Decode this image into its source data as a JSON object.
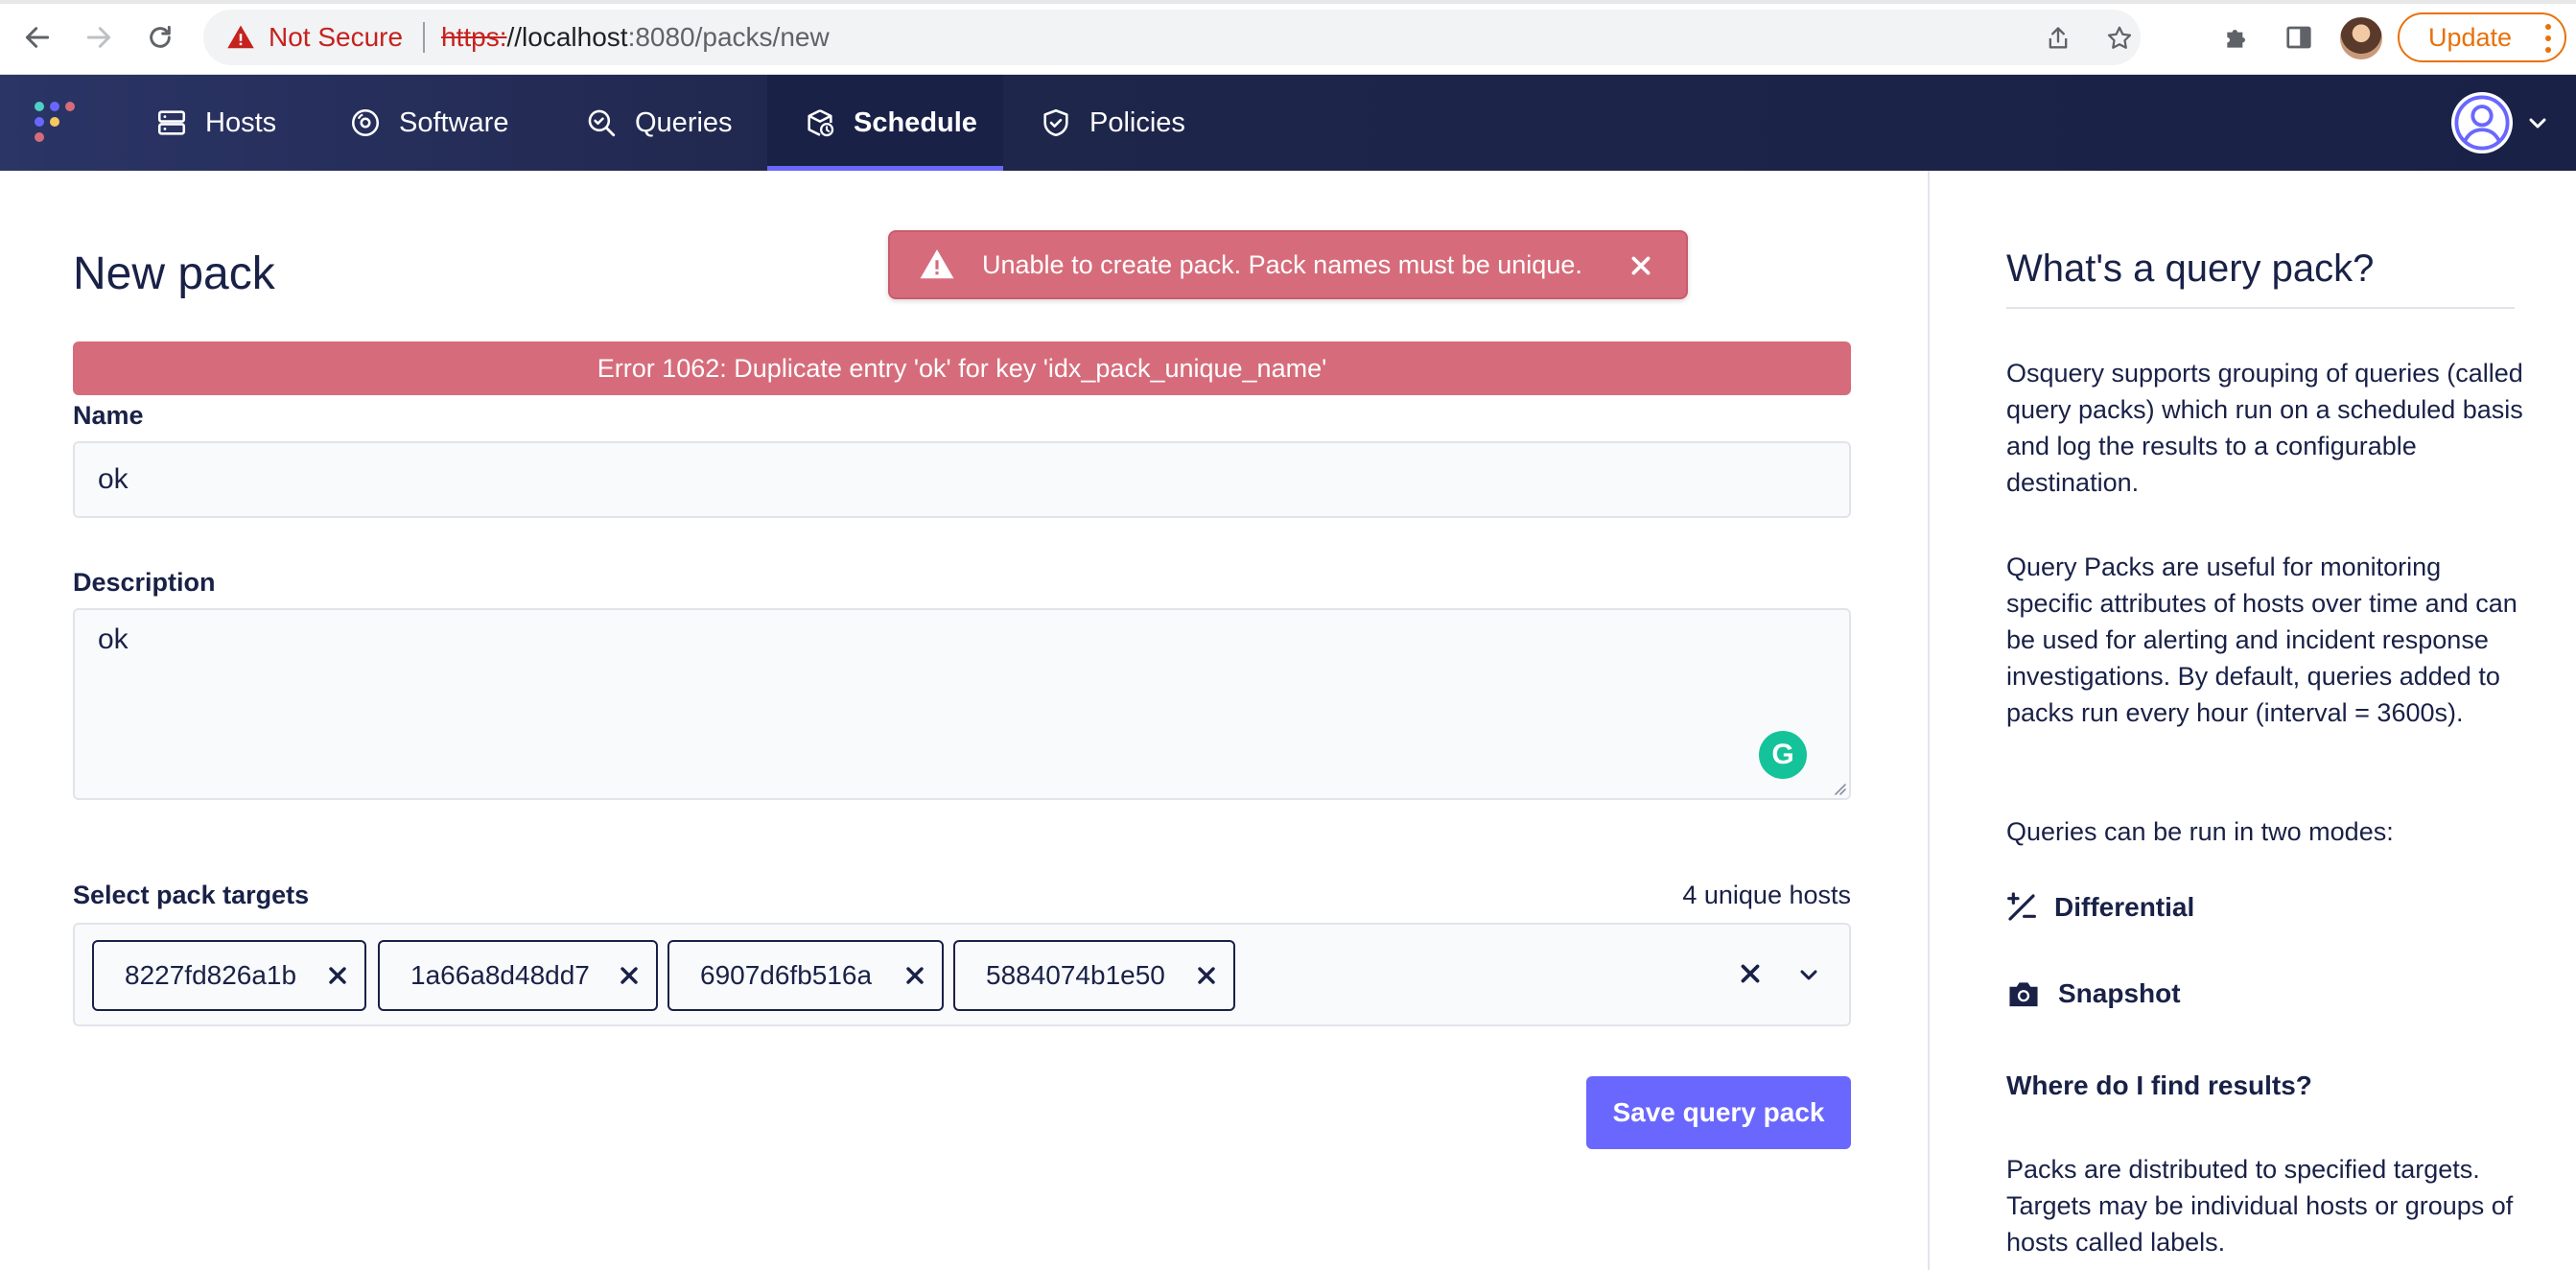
{
  "browser": {
    "security_label": "Not Secure",
    "url_scheme": "https:",
    "url_host": "//localhost",
    "url_rest": ":8080/packs/new",
    "update_label": "Update"
  },
  "nav": {
    "items": [
      {
        "label": "Hosts",
        "icon": "hosts-icon"
      },
      {
        "label": "Software",
        "icon": "software-icon"
      },
      {
        "label": "Queries",
        "icon": "queries-icon"
      },
      {
        "label": "Schedule",
        "icon": "schedule-icon",
        "active": true
      },
      {
        "label": "Policies",
        "icon": "policies-icon"
      }
    ]
  },
  "page": {
    "title": "New pack",
    "flash_message": "Unable to create pack. Pack names must be unique.",
    "error_message": "Error 1062: Duplicate entry 'ok' for key 'idx_pack_unique_name'"
  },
  "form": {
    "name_label": "Name",
    "name_value": "ok",
    "description_label": "Description",
    "description_value": "ok",
    "targets_label": "Select pack targets",
    "hosts_count": "4 unique hosts",
    "targets": [
      "8227fd826a1b",
      "1a66a8d48dd7",
      "6907d6fb516a",
      "5884074b1e50"
    ],
    "save_label": "Save query pack"
  },
  "sidebar": {
    "title": "What's a query pack?",
    "p1": "Osquery supports grouping of queries (called query packs) which run on a scheduled basis and log the results to a configurable destination.",
    "p2": "Query Packs are useful for monitoring specific attributes of hosts over time and can be used for alerting and incident response investigations. By default, queries added to packs run every hour (interval = 3600s).",
    "p3": "Queries can be run in two modes:",
    "mode_differential": "Differential",
    "mode_snapshot": "Snapshot",
    "results_heading": "Where do I find results?",
    "p4": "Packs are distributed to specified targets. Targets may be individual hosts or groups of hosts called labels."
  },
  "colors": {
    "nav_bg": "#192147",
    "accent": "#6a67fe",
    "error": "#d66c7b"
  }
}
